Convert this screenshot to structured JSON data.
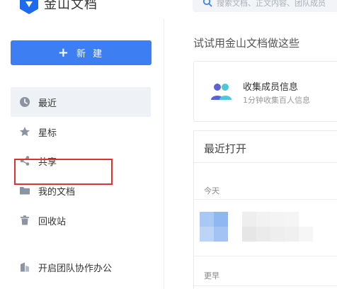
{
  "app": {
    "title": "金山文档"
  },
  "search": {
    "placeholder": "搜索文档、正文内容、团队成员"
  },
  "sidebar": {
    "new_button_label": "新 建",
    "items": [
      {
        "label": "最近",
        "icon": "clock-icon",
        "active": true
      },
      {
        "label": "星标",
        "icon": "star-icon"
      },
      {
        "label": "共享",
        "icon": "share-icon"
      },
      {
        "label": "我的文档",
        "icon": "folder-icon",
        "highlighted": true
      },
      {
        "label": "回收站",
        "icon": "trash-icon"
      }
    ],
    "team_item": {
      "label": "开启团队协作办公",
      "icon": "team-building-icon"
    }
  },
  "main": {
    "section_heading": "试试用金山文档做这些",
    "template_card": {
      "title": "收集成员信息",
      "subtitle": "1分钟收集百人信息",
      "icon": "people-icon"
    },
    "recent": {
      "heading": "最近打开",
      "groups": [
        {
          "label": "今天"
        },
        {
          "label": "更早"
        }
      ]
    }
  },
  "colors": {
    "accent": "#3d7ff2",
    "highlight_box": "#e03030",
    "active_bg": "#eef1f5"
  }
}
